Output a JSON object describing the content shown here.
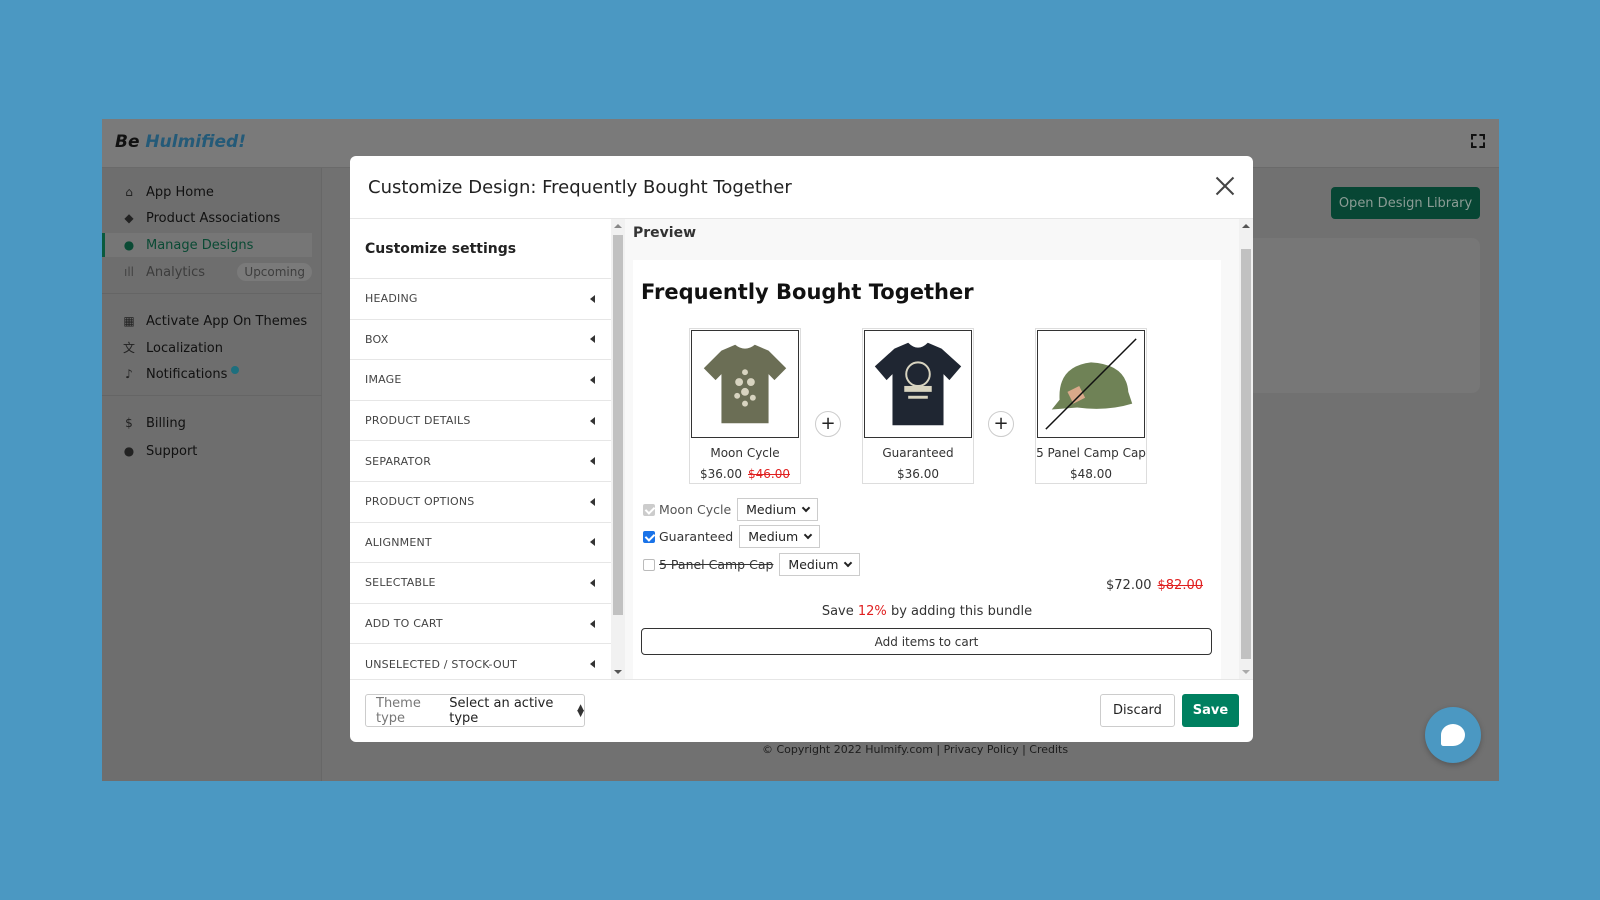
{
  "app": {
    "logo_prefix": "Be",
    "logo_brand": "Hulmified!"
  },
  "sidebar": {
    "items": [
      {
        "label": "App Home",
        "icon": "home-icon"
      },
      {
        "label": "Product Associations",
        "icon": "tag-icon"
      },
      {
        "label": "Manage Designs",
        "icon": "palette-icon",
        "active": true
      },
      {
        "label": "Analytics",
        "icon": "bar-chart-icon",
        "badge": "Upcoming"
      },
      {
        "label": "Activate App On Themes",
        "icon": "layout-icon"
      },
      {
        "label": "Localization",
        "icon": "translate-icon"
      },
      {
        "label": "Notifications",
        "icon": "bell-icon"
      },
      {
        "label": "Billing",
        "icon": "receipt-icon"
      },
      {
        "label": "Support",
        "icon": "chat-icon"
      }
    ]
  },
  "page": {
    "open_design_library": "Open Design Library",
    "footer": "© Copyright 2022 Hulmify.com | Privacy Policy | Credits"
  },
  "modal": {
    "title": "Customize Design: Frequently Bought Together",
    "settings_title": "Customize settings",
    "sections": [
      "HEADING",
      "BOX",
      "IMAGE",
      "PRODUCT DETAILS",
      "SEPARATOR",
      "PRODUCT OPTIONS",
      "ALIGNMENT",
      "SELECTABLE",
      "ADD TO CART",
      "UNSELECTED / STOCK-OUT"
    ],
    "preview_label": "Preview",
    "preview": {
      "heading": "Frequently Bought Together",
      "products": [
        {
          "name": "Moon Cycle",
          "price": "$36.00",
          "compare_price": "$46.00"
        },
        {
          "name": "Guaranteed",
          "price": "$36.00"
        },
        {
          "name": "5 Panel Camp Cap",
          "price": "$48.00"
        }
      ],
      "options": [
        {
          "name": "Moon Cycle",
          "variant": "Medium",
          "state": "checked-disabled"
        },
        {
          "name": "Guaranteed",
          "variant": "Medium",
          "state": "checked"
        },
        {
          "name": "5 Panel Camp Cap",
          "variant": "Medium",
          "state": "unchecked"
        }
      ],
      "total": "$72.00",
      "total_compare": "$82.00",
      "save_prefix": "Save",
      "save_percent": "12%",
      "save_suffix": "by adding this bundle",
      "add_to_cart": "Add items to cart"
    },
    "footer": {
      "theme_label": "Theme type",
      "theme_value": "Select an active type",
      "discard": "Discard",
      "save": "Save"
    }
  },
  "colors": {
    "primary": "#008060",
    "background": "#4b98c2",
    "discount": "#e02020"
  }
}
